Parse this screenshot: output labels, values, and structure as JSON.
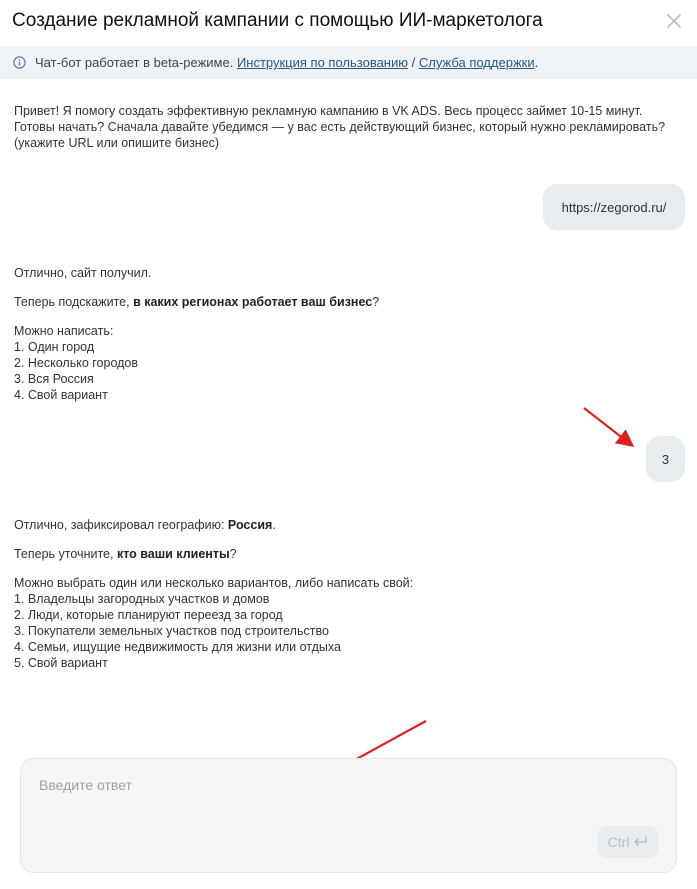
{
  "header": {
    "title": "Создание рекламной кампании с помощью ИИ-маркетолога"
  },
  "beta": {
    "text": "Чат-бот работает в beta-режиме.",
    "link_manual": "Инструкция по пользованию",
    "separator": "/",
    "link_support": "Служба поддержки",
    "end": "."
  },
  "messages": {
    "bot1": {
      "line1": "Привет! Я помогу создать эффективную рекламную кампанию в VK ADS. Весь процесс займет 10-15 минут.",
      "line2": "Готовы начать? Сначала давайте убедимся — у вас есть действующий бизнес, который нужно рекламировать?",
      "line3": "(укажите URL или опишите бизнес)"
    },
    "user1": "https://zegorod.ru/",
    "bot2": {
      "p1": "Отлично, сайт получил.",
      "p2_pre": "Теперь подскажите, ",
      "p2_bold": "в каких регионах работает ваш бизнес",
      "p2_post": "?",
      "intro": "Можно написать:",
      "options": [
        "1. Один город",
        "2. Несколько городов",
        "3. Вся Россия",
        "4. Свой вариант"
      ]
    },
    "user2": "3",
    "bot3": {
      "p1_pre": "Отлично, зафиксировал географию: ",
      "p1_bold": "Россия",
      "p1_post": ".",
      "p2_pre": "Теперь уточните, ",
      "p2_bold": "кто ваши клиенты",
      "p2_post": "?",
      "intro": "Можно выбрать один или несколько вариантов, либо написать свой:",
      "options": [
        "1. Владельцы загородных участков и домов",
        "2. Люди, которые планируют переезд за город",
        "3. Покупатели земельных участков под строительство",
        "4. Семьи, ищущие недвижимость для жизни или отдыха",
        "5. Свой вариант"
      ]
    }
  },
  "composer": {
    "placeholder": "Введите ответ",
    "send_label": "Ctrl"
  },
  "colors": {
    "link": "#2a5885",
    "bubble": "#e7ecef",
    "arrow": "#e02020",
    "beta_bg": "#eef3f7"
  },
  "icons": [
    "close-icon",
    "info-icon",
    "enter-icon",
    "annotation-arrow"
  ]
}
